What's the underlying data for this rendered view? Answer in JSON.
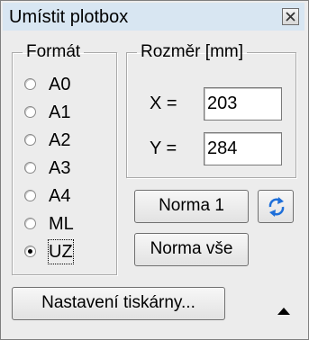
{
  "window": {
    "title": "Umístit plotbox",
    "close_icon": "close-icon"
  },
  "format_group": {
    "legend": "Formát",
    "options": [
      "A0",
      "A1",
      "A2",
      "A3",
      "A4",
      "ML",
      "UZ"
    ],
    "selected": "UZ"
  },
  "size_group": {
    "legend": "Rozměr [mm]",
    "x_label": "X =",
    "x_value": "203",
    "y_label": "Y =",
    "y_value": "284"
  },
  "buttons": {
    "norma1": "Norma 1",
    "refresh_icon": "swap-arrows-icon",
    "norma_vse": "Norma vše",
    "printer_settings": "Nastavení tiskárny..."
  },
  "colors": {
    "titlebar": "#d8e6f2",
    "window_bg": "#ececec",
    "refresh_icon": "#1e6fd9"
  }
}
